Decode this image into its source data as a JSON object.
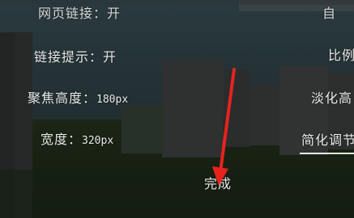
{
  "left_panel": {
    "top_cut_text": "网页链接：开",
    "link_hint": {
      "label": "链接提示：",
      "value": "开"
    },
    "focus_height": {
      "label": "聚焦高度：",
      "value": "180px"
    },
    "width": {
      "label": "宽度：",
      "value": "320px"
    }
  },
  "right_panel": {
    "top_cut_text": "自",
    "scale_label": "比例",
    "fade_label": "淡化高",
    "simplified_tab": "简化调节"
  },
  "done_button": "完成",
  "colors": {
    "sky": "#1f2e33",
    "ground": "#1a2413",
    "text": "#e9e9e9",
    "annotation_arrow": "#e8231e"
  }
}
